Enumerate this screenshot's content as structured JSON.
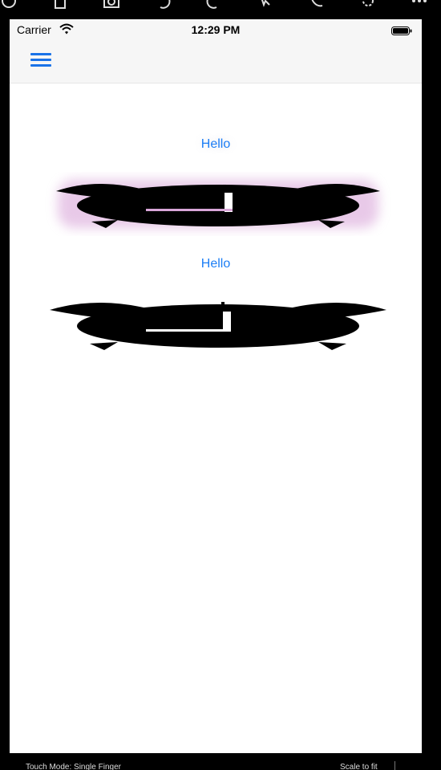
{
  "emulator": {
    "toolbar_icons": [
      "power-icon",
      "device-icon",
      "camera-icon",
      "rotate-left-icon",
      "rotate-right-icon",
      "gesture-icon",
      "phone-icon",
      "settings-icon",
      "more-icon"
    ],
    "bottom_left": "Touch Mode: Single Finger",
    "bottom_right": "Scale to fit"
  },
  "status_bar": {
    "carrier": "Carrier",
    "time": "12:29 PM"
  },
  "nav_bar": {
    "menu_icon": "hamburger-menu-icon",
    "accent": "#1a73e8"
  },
  "content": {
    "button_1": "Hello",
    "image_1": "alarm-clock-image",
    "button_2": "Hello",
    "image_2": "alarm-clock-image",
    "link_color": "#1c7ef5"
  }
}
